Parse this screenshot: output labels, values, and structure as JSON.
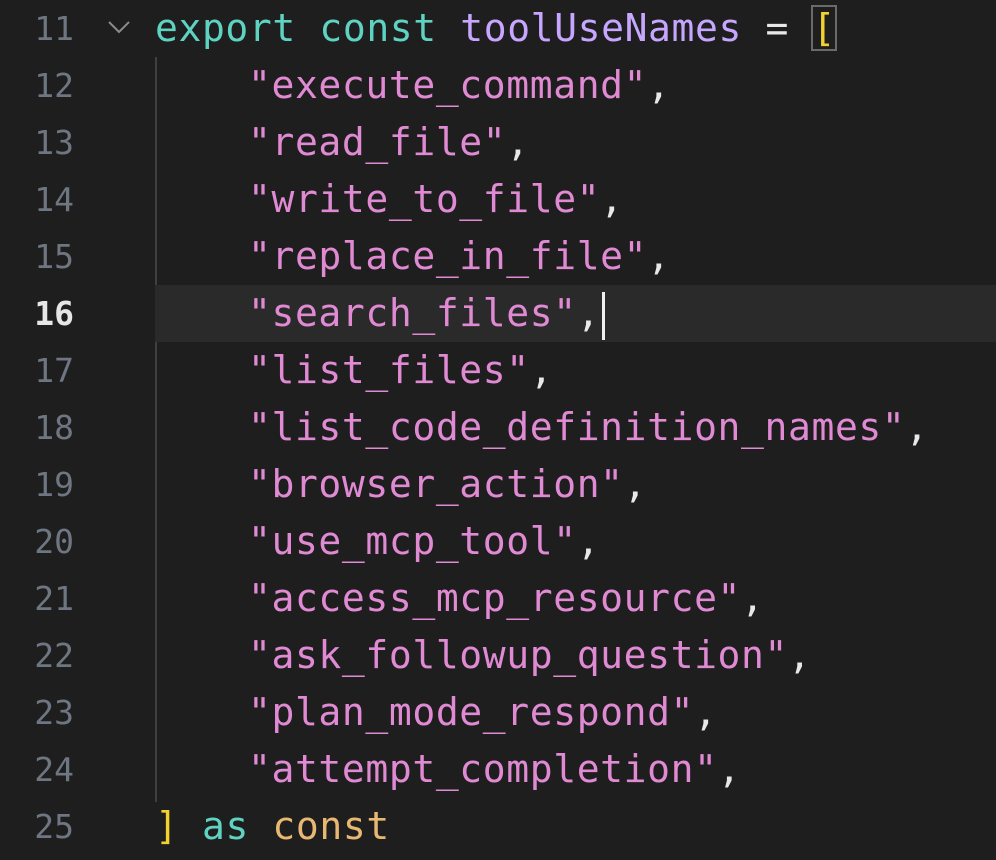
{
  "editor": {
    "current_line": "16",
    "lines": [
      {
        "num": "11",
        "parts": {
          "kw1": "export",
          "kw2": "const",
          "id": "toolUseNames",
          "op": "=",
          "bracket": "["
        }
      },
      {
        "num": "12",
        "text": "\"execute_command\"",
        "punc": ","
      },
      {
        "num": "13",
        "text": "\"read_file\"",
        "punc": ","
      },
      {
        "num": "14",
        "text": "\"write_to_file\"",
        "punc": ","
      },
      {
        "num": "15",
        "text": "\"replace_in_file\"",
        "punc": ","
      },
      {
        "num": "16",
        "text": "\"search_files\"",
        "punc": ","
      },
      {
        "num": "17",
        "text": "\"list_files\"",
        "punc": ","
      },
      {
        "num": "18",
        "text": "\"list_code_definition_names\"",
        "punc": ","
      },
      {
        "num": "19",
        "text": "\"browser_action\"",
        "punc": ","
      },
      {
        "num": "20",
        "text": "\"use_mcp_tool\"",
        "punc": ","
      },
      {
        "num": "21",
        "text": "\"access_mcp_resource\"",
        "punc": ","
      },
      {
        "num": "22",
        "text": "\"ask_followup_question\"",
        "punc": ","
      },
      {
        "num": "23",
        "text": "\"plan_mode_respond\"",
        "punc": ","
      },
      {
        "num": "24",
        "text": "\"attempt_completion\"",
        "punc": ","
      },
      {
        "num": "25",
        "parts": {
          "bracket": "]",
          "kw1": "as",
          "kw2": "const"
        }
      }
    ]
  },
  "colors": {
    "background": "#1e1e1e",
    "keyword": "#5fd3c1",
    "identifier": "#c7a6ff",
    "string": "#e08ad4",
    "bracket": "#f2d231",
    "const": "#e8b872",
    "line_number": "#6e7681",
    "current_line_number": "#e6e6e6"
  },
  "icons": {
    "fold": "chevron-down-icon"
  }
}
